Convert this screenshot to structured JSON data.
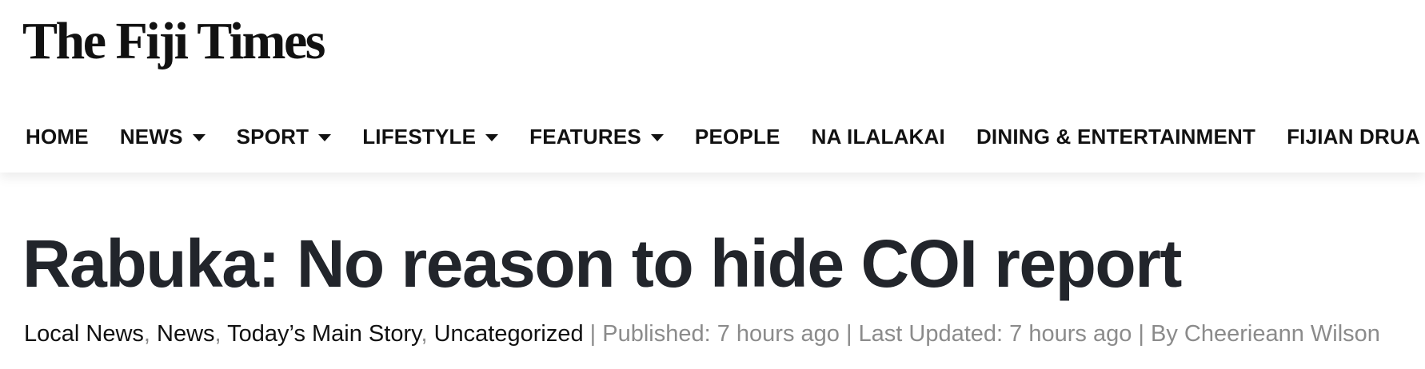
{
  "site": {
    "logo_text": "The Fiji Times"
  },
  "nav": {
    "items": [
      {
        "label": "HOME",
        "has_dropdown": false
      },
      {
        "label": "NEWS",
        "has_dropdown": true
      },
      {
        "label": "SPORT",
        "has_dropdown": true
      },
      {
        "label": "LIFESTYLE",
        "has_dropdown": true
      },
      {
        "label": "FEATURES",
        "has_dropdown": true
      },
      {
        "label": "PEOPLE",
        "has_dropdown": false
      },
      {
        "label": "NA ILALAKAI",
        "has_dropdown": false
      },
      {
        "label": "DINING & ENTERTAINMENT",
        "has_dropdown": false
      },
      {
        "label": "FIJIAN DRUA",
        "has_dropdown": false
      }
    ]
  },
  "article": {
    "title": "Rabuka: No reason to hide COI report",
    "categories": [
      "Local News",
      "News",
      "Today’s Main Story",
      "Uncategorized"
    ],
    "category_separator": ", ",
    "published": "Published: 7 hours ago",
    "last_updated": "Last Updated: 7 hours ago",
    "byline": "By Cheerieann Wilson",
    "meta_separator": " | "
  },
  "colors": {
    "title": "#22252b",
    "meta_gray": "#8b8b8b",
    "text": "#111111",
    "background": "#ffffff"
  }
}
